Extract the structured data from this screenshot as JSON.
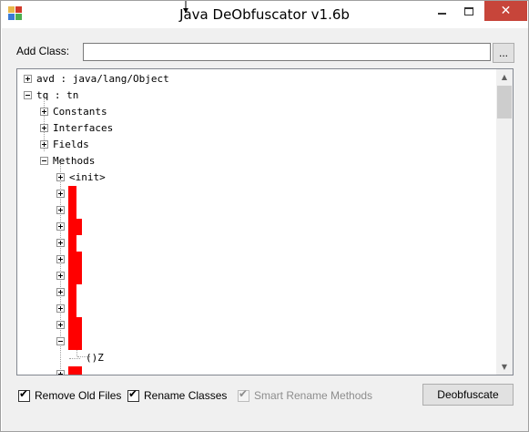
{
  "window": {
    "title": "Java DeObfuscator v1.6b",
    "close_color": "#c7453a"
  },
  "add_class": {
    "label": "Add Class:",
    "value": "",
    "browse_label": "..."
  },
  "tree": {
    "highlight_color": "#ff0000",
    "nodes": [
      {
        "label": "avd : java/lang/Object",
        "expander": "plus",
        "highlighted": false
      },
      {
        "label": "tq : tn",
        "expander": "minus",
        "highlighted": false
      },
      {
        "label": "Constants",
        "expander": "plus",
        "highlighted": false
      },
      {
        "label": "Interfaces",
        "expander": "plus",
        "highlighted": false
      },
      {
        "label": "Fields",
        "expander": "plus",
        "highlighted": false
      },
      {
        "label": "Methods",
        "expander": "minus",
        "highlighted": false
      },
      {
        "label": "<init>",
        "expander": "plus",
        "highlighted": false
      },
      {
        "label": "h",
        "expander": "plus",
        "highlighted": true
      },
      {
        "label": "r",
        "expander": "plus",
        "highlighted": true
      },
      {
        "label": "cl",
        "expander": "plus",
        "highlighted": true
      },
      {
        "label": "a",
        "expander": "plus",
        "highlighted": true
      },
      {
        "label": "cm",
        "expander": "plus",
        "highlighted": true
      },
      {
        "label": "e_",
        "expander": "plus",
        "highlighted": true
      },
      {
        "label": "w",
        "expander": "plus",
        "highlighted": true
      },
      {
        "label": "c",
        "expander": "plus",
        "highlighted": true
      },
      {
        "label": "cn",
        "expander": "plus",
        "highlighted": true
      },
      {
        "label": "co",
        "expander": "minus",
        "highlighted": true
      },
      {
        "label": "()Z",
        "expander": "none",
        "highlighted": false
      },
      {
        "label": "cp",
        "expander": "plus",
        "highlighted": true
      }
    ]
  },
  "options": {
    "remove_old_files": {
      "label": "Remove Old Files",
      "checked": true,
      "enabled": true
    },
    "rename_classes": {
      "label": "Rename Classes",
      "checked": true,
      "enabled": true
    },
    "smart_rename_methods": {
      "label": "Smart Rename Methods",
      "checked": true,
      "enabled": false
    }
  },
  "deobfuscate_button": {
    "label": "Deobfuscate"
  },
  "icons": {
    "app": "app-icon",
    "minimize": "minimize-icon",
    "maximize": "maximize-icon",
    "close": "close-icon",
    "checkmark": "checkmark-icon",
    "scroll_up": "scroll-up-arrow-icon",
    "scroll_down": "scroll-down-arrow-icon"
  }
}
